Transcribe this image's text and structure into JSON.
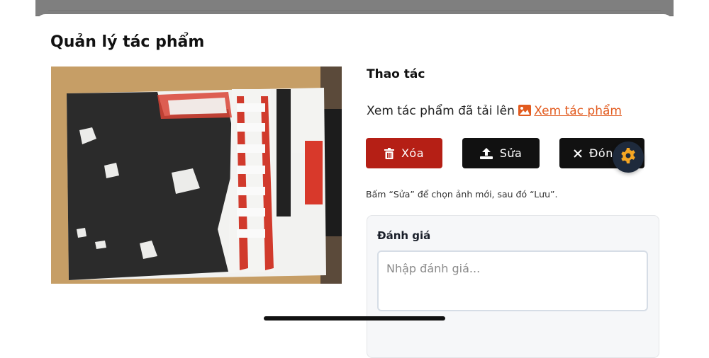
{
  "modal": {
    "title": "Quản lý tác phẩm"
  },
  "artwork": {
    "image": "uploaded-artwork-photo"
  },
  "actions": {
    "heading": "Thao tác",
    "view_prefix": "Xem tác phẩm đã tải lên",
    "view_link": "Xem tác phẩm",
    "delete_label": "Xóa",
    "edit_label": "Sửa",
    "close_label": "Đóng",
    "hint": "Bấm “Sửa” để chọn ảnh mới, sau đó “Lưu”."
  },
  "review": {
    "title": "Đánh giá",
    "placeholder": "Nhập đánh giá..."
  },
  "icons": {
    "delete": "trash-icon",
    "edit": "upload-icon",
    "close": "close-icon",
    "view": "image-icon",
    "fab": "gear-icon"
  },
  "colors": {
    "delete_button": "#b51f15",
    "dark_button": "#111111",
    "link": "#e25b1f",
    "gear": "#f5a623"
  }
}
